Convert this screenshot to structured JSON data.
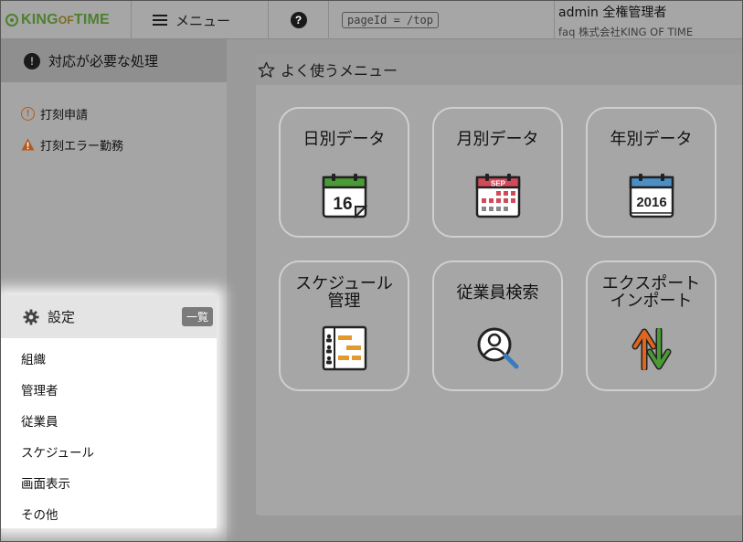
{
  "header": {
    "logo_main": "KING",
    "logo_of": "OF",
    "logo_end": "TIME",
    "menu_label": "メニュー",
    "help_label": "?",
    "page_id": "pageId = /top",
    "user_name": "admin 全権管理者",
    "user_company": "faq 株式会社KING OF TIME"
  },
  "sidebar": {
    "notice_title": "対応が必要な処理",
    "notice_items": [
      {
        "label": "打刻申請",
        "icon": "warning-circle-icon"
      },
      {
        "label": "打刻エラー勤務",
        "icon": "warning-triangle-icon"
      }
    ],
    "settings_title": "設定",
    "settings_list_button": "一覧",
    "settings_items": [
      "組織",
      "管理者",
      "従業員",
      "スケジュール",
      "画面表示",
      "その他"
    ]
  },
  "main": {
    "section_title": "よく使うメニュー",
    "tiles": [
      {
        "label": "日別データ",
        "icon": "calendar-day-icon",
        "icon_text": "16"
      },
      {
        "label": "月別データ",
        "icon": "calendar-month-icon",
        "icon_text": "SEP"
      },
      {
        "label": "年別データ",
        "icon": "calendar-year-icon",
        "icon_text": "2016"
      },
      {
        "label_line1": "スケジュール",
        "label_line2": "管理",
        "icon": "schedule-icon"
      },
      {
        "label": "従業員検索",
        "icon": "employee-search-icon"
      },
      {
        "label_line1": "エクスポート",
        "label_line2": "インポート",
        "icon": "export-import-icon"
      }
    ]
  },
  "colors": {
    "brand_green": "#4e7f2e",
    "warning_orange": "#b35b1a",
    "calendar_green": "#4a9a35",
    "calendar_red": "#d24a5a",
    "calendar_blue": "#4b8fc4",
    "export_orange": "#e0661e",
    "import_green": "#4a9a35"
  }
}
